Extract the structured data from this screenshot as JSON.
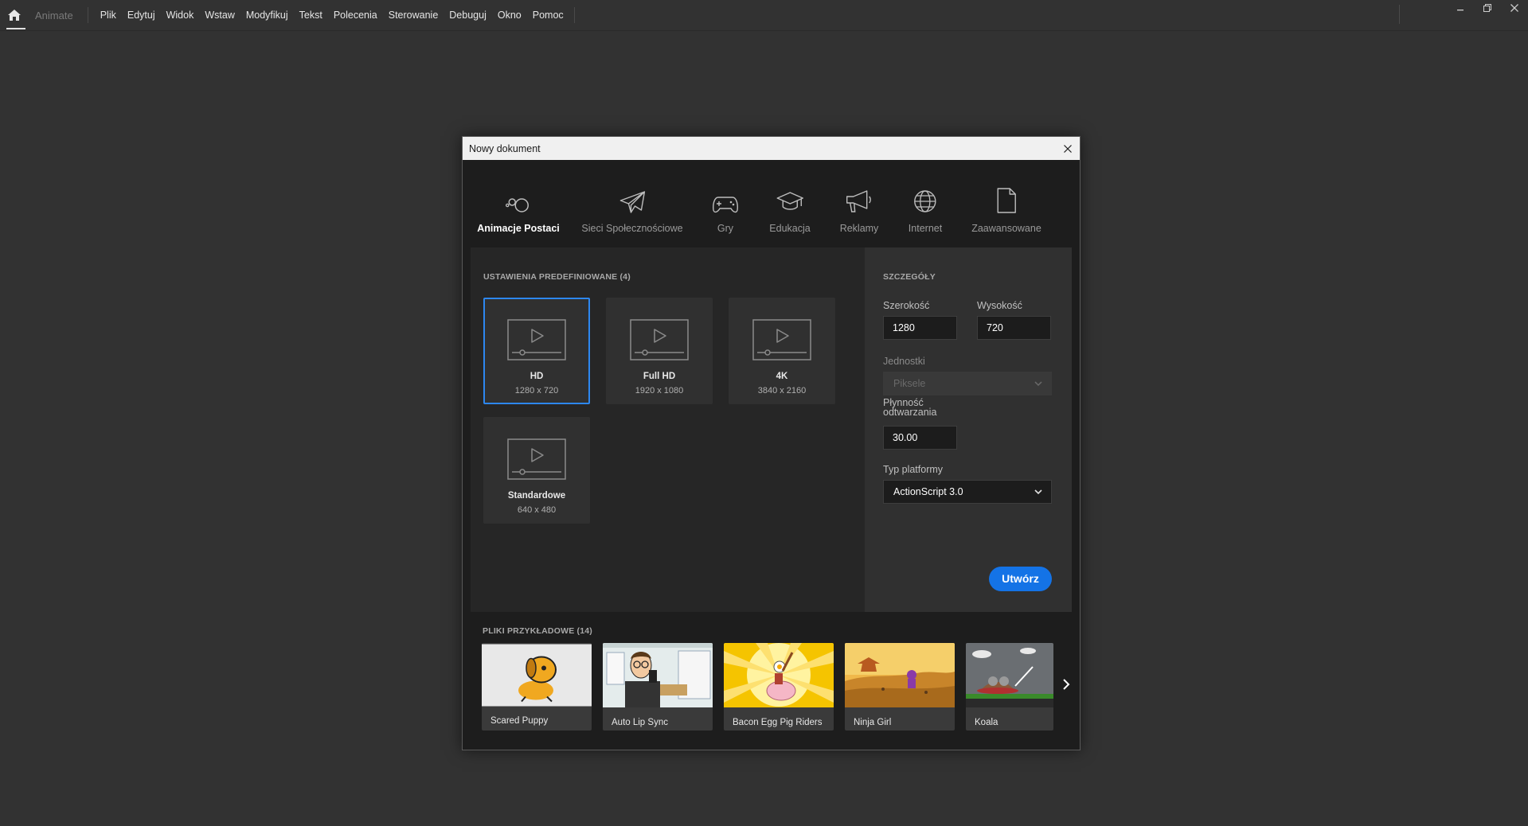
{
  "app": {
    "name": "Animate"
  },
  "menu": [
    "Plik",
    "Edytuj",
    "Widok",
    "Wstaw",
    "Modyfikuj",
    "Tekst",
    "Polecenia",
    "Sterowanie",
    "Debuguj",
    "Okno",
    "Pomoc"
  ],
  "dialog": {
    "title": "Nowy dokument",
    "categories": [
      {
        "label": "Animacje Postaci",
        "icon": "character-animation-icon",
        "active": true
      },
      {
        "label": "Sieci Społecznościowe",
        "icon": "paper-plane-icon",
        "active": false
      },
      {
        "label": "Gry",
        "icon": "gamepad-icon",
        "active": false
      },
      {
        "label": "Edukacja",
        "icon": "graduation-cap-icon",
        "active": false
      },
      {
        "label": "Reklamy",
        "icon": "megaphone-icon",
        "active": false
      },
      {
        "label": "Internet",
        "icon": "globe-icon",
        "active": false
      },
      {
        "label": "Zaawansowane",
        "icon": "document-icon",
        "active": false
      }
    ],
    "presets": {
      "title": "USTAWIENIA PREDEFINIOWANE (4)",
      "items": [
        {
          "name": "HD",
          "size": "1280 x 720",
          "selected": true
        },
        {
          "name": "Full HD",
          "size": "1920 x 1080",
          "selected": false
        },
        {
          "name": "4K",
          "size": "3840 x 2160",
          "selected": false
        },
        {
          "name": "Standardowe",
          "size": "640 x 480",
          "selected": false
        }
      ]
    },
    "details": {
      "title": "SZCZEGÓŁY",
      "width_label": "Szerokość",
      "width_value": "1280",
      "height_label": "Wysokość",
      "height_value": "720",
      "units_label": "Jednostki",
      "units_value": "Piksele",
      "fps_label_line1": "Płynność",
      "fps_label_line2": "odtwarzania",
      "fps_value": "30.00",
      "platform_label": "Typ platformy",
      "platform_value": "ActionScript 3.0",
      "create_label": "Utwórz"
    },
    "samples": {
      "title": "PLIKI PRZYKŁADOWE (14)",
      "items": [
        {
          "name": "Scared Puppy"
        },
        {
          "name": "Auto Lip Sync"
        },
        {
          "name": "Bacon Egg Pig Riders"
        },
        {
          "name": "Ninja Girl"
        },
        {
          "name": "Koala"
        }
      ]
    }
  },
  "colors": {
    "accent": "#1473e6",
    "selected_border": "#2d87f0",
    "background": "#323232",
    "dialog_bg": "#1d1d1d"
  }
}
